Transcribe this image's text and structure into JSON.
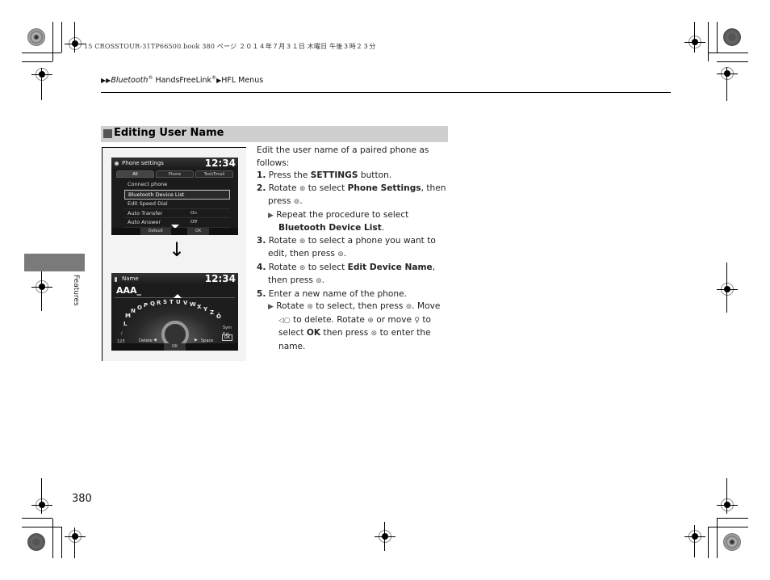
{
  "print_header": "15 CROSSTOUR-31TP66500.book  380 ページ  ２０１４年７月３１日  木曜日  午後３時２３分",
  "breadcrumb": {
    "items": [
      "Bluetooth",
      "HandsFreeLink",
      "HFL Menus"
    ],
    "registered_mark": "®",
    "separator_icon": "▶"
  },
  "section": {
    "title": "Editing User Name"
  },
  "figure": {
    "screen1": {
      "title": "Phone settings",
      "clock": "12:34",
      "tabs": [
        "All",
        "Phone",
        "Text/Email"
      ],
      "menu": [
        {
          "label": "Connect phone",
          "value": ""
        },
        {
          "label": "Bluetooth Device List",
          "value": "",
          "selected": true
        },
        {
          "label": "Edit Speed Dial",
          "value": ""
        },
        {
          "label": "Auto Transfer",
          "value": "On"
        },
        {
          "label": "Auto Answer",
          "value": "Off"
        }
      ],
      "buttons": [
        "Default",
        "OK"
      ]
    },
    "arrow": "↓",
    "screen2": {
      "title": "Name",
      "clock": "12:34",
      "input_value": "AAA_",
      "letters": [
        "L",
        "M",
        "N",
        "O",
        "P",
        "Q",
        "R",
        "S",
        "T",
        "U",
        "V",
        "W",
        "X",
        "Y",
        "Z",
        "Ö"
      ],
      "left_labels": [
        "/",
        "123"
      ],
      "right_labels": [
        "Sym",
        "Ext"
      ],
      "delete_label": "Delete",
      "space_label": "Space",
      "ok_label": "OK",
      "bottom_ok": "OK"
    }
  },
  "instructions": {
    "intro": "Edit the user name of a paired phone as follows:",
    "steps": [
      {
        "num": "1.",
        "pre": "Press the ",
        "bold": "SETTINGS",
        "post": " button."
      },
      {
        "num": "2.",
        "pre": "Rotate ",
        "icon": "⊛",
        "mid": " to select ",
        "bold": "Phone Settings",
        "post": ", then press ",
        "icon2": "⊚",
        "end": "."
      },
      {
        "sub_pre": "Repeat the procedure to select ",
        "sub_bold": "Bluetooth Device List",
        "sub_end": "."
      },
      {
        "num": "3.",
        "pre": "Rotate ",
        "icon": "⊛",
        "mid": " to select a phone you want to edit, then press ",
        "icon2": "⊚",
        "end": "."
      },
      {
        "num": "4.",
        "pre": "Rotate ",
        "icon": "⊛",
        "mid": " to select ",
        "bold": "Edit Device Name",
        "post": ", then press ",
        "icon2": "⊚",
        "end": "."
      },
      {
        "num": "5.",
        "pre": "Enter a new name of the phone."
      },
      {
        "sub_a": "Rotate ",
        "sub_b": " to select, then press ",
        "sub_c": ". Move ",
        "sub_d": " to delete. Rotate ",
        "sub_e": " or move ",
        "sub_f": " to select ",
        "sub_bold": "OK",
        "sub_g": " then press ",
        "sub_h": " to enter the name."
      }
    ],
    "icons": {
      "rotate": "⊛",
      "press": "⊚",
      "move_left": "◁○",
      "move_down": "♀",
      "bullet": "▶"
    }
  },
  "side": {
    "label": "Features"
  },
  "page_number": "380"
}
